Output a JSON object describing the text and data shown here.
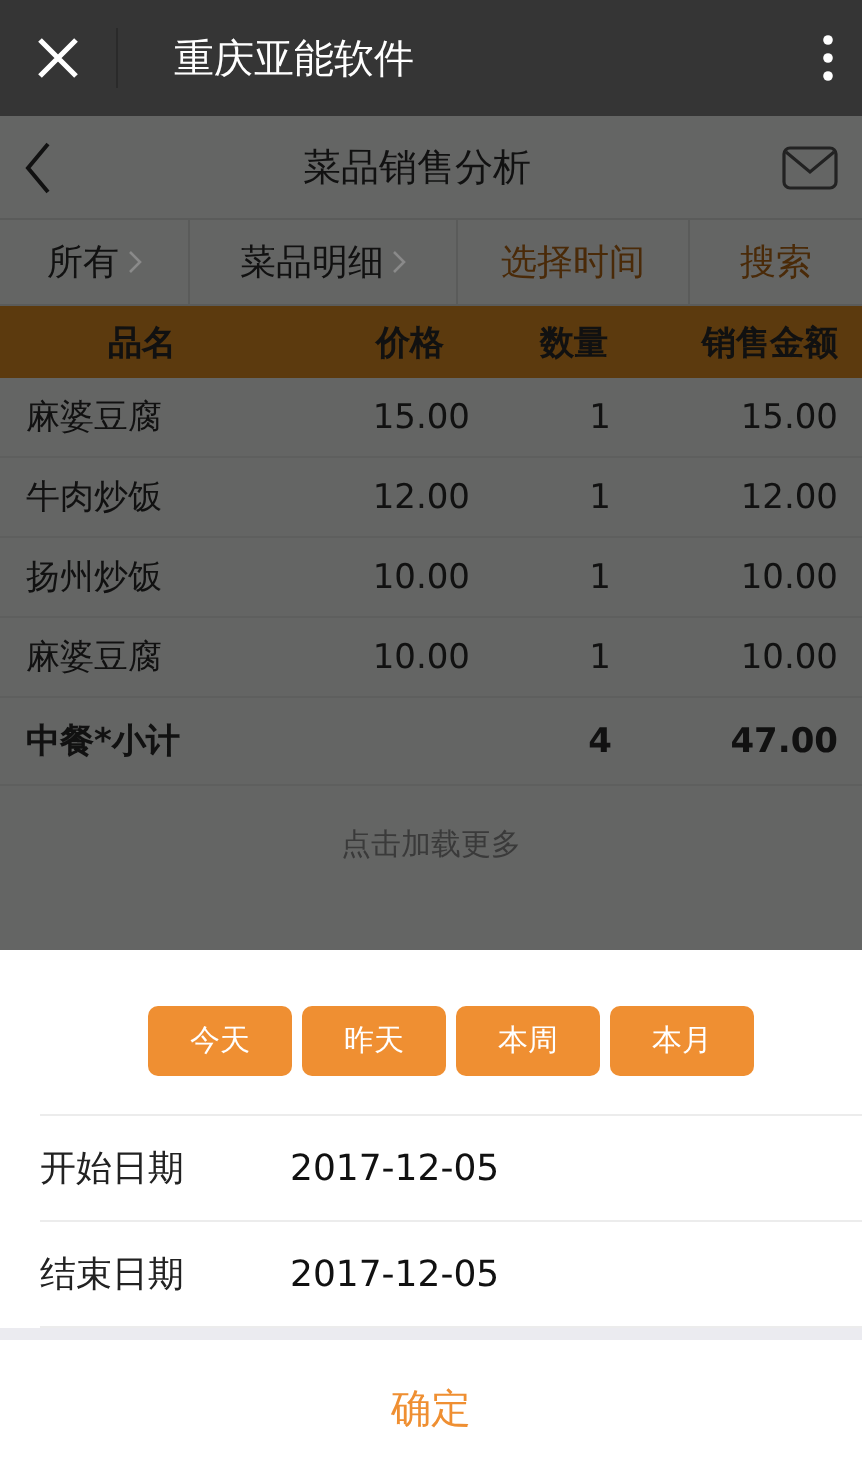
{
  "window": {
    "title": "重庆亚能软件"
  },
  "header": {
    "title": "菜品销售分析"
  },
  "filters": [
    {
      "label": "所有",
      "kind": "dropdown"
    },
    {
      "label": "菜品明细",
      "kind": "dropdown"
    },
    {
      "label": "选择时间",
      "kind": "action"
    },
    {
      "label": "搜索",
      "kind": "action"
    }
  ],
  "table": {
    "columns": [
      "品名",
      "价格",
      "数量",
      "销售金额"
    ],
    "rows": [
      {
        "kind": "item",
        "cells": [
          "麻婆豆腐",
          "15.00",
          "1",
          "15.00"
        ]
      },
      {
        "kind": "item",
        "cells": [
          "牛肉炒饭",
          "12.00",
          "1",
          "12.00"
        ]
      },
      {
        "kind": "item",
        "cells": [
          "扬州炒饭",
          "10.00",
          "1",
          "10.00"
        ]
      },
      {
        "kind": "item",
        "cells": [
          "麻婆豆腐",
          "10.00",
          "1",
          "10.00"
        ]
      },
      {
        "kind": "subtotal",
        "cells": [
          "中餐*小计",
          "",
          "4",
          "47.00"
        ]
      }
    ]
  },
  "load_more": "点击加载更多",
  "sheet": {
    "quick_buttons": [
      "今天",
      "昨天",
      "本周",
      "本月"
    ],
    "fields": [
      {
        "label": "开始日期",
        "value": "2017-12-05"
      },
      {
        "label": "结束日期",
        "value": "2017-12-05"
      }
    ],
    "confirm": "确定"
  }
}
